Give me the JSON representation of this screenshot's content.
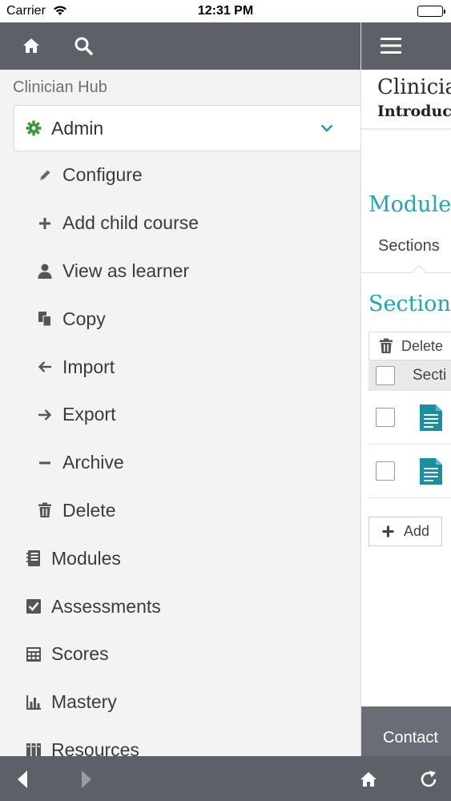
{
  "status_bar": {
    "carrier": "Carrier",
    "time": "12:31 PM"
  },
  "drawer": {
    "hub_title": "Clinician Hub",
    "admin": {
      "label": "Admin",
      "icon": "gear-icon",
      "accent": "#3a9a3a"
    },
    "admin_items": [
      {
        "label": "Configure",
        "icon": "pencil-icon"
      },
      {
        "label": "Add child course",
        "icon": "plus-icon"
      },
      {
        "label": "View as learner",
        "icon": "person-icon"
      },
      {
        "label": "Copy",
        "icon": "copy-icon"
      },
      {
        "label": "Import",
        "icon": "arrow-left-icon"
      },
      {
        "label": "Export",
        "icon": "arrow-right-icon"
      },
      {
        "label": "Archive",
        "icon": "minus-icon"
      },
      {
        "label": "Delete",
        "icon": "trash-icon"
      }
    ],
    "main_items": [
      {
        "label": "Modules",
        "icon": "notebook-icon"
      },
      {
        "label": "Assessments",
        "icon": "checkbox-icon"
      },
      {
        "label": "Scores",
        "icon": "calculator-icon"
      },
      {
        "label": "Mastery",
        "icon": "bar-chart-icon"
      },
      {
        "label": "Resources",
        "icon": "books-icon"
      }
    ]
  },
  "content": {
    "course_title": "Clinicia",
    "course_subtitle": "Introduct",
    "module_heading": "Module",
    "tab_sections": "Sections",
    "sections_heading": "Section",
    "delete_label": "Delete",
    "header_col": "Secti",
    "rows": [
      {
        "icon": "document-icon"
      },
      {
        "icon": "document-icon"
      }
    ],
    "add_label": "Add",
    "footer_contact": "Contact",
    "accent": "#1ea5b8"
  },
  "colors": {
    "header_bg": "#5d6167",
    "drawer_bg": "#f3f3f3",
    "doc_icon": "#1a8fa0"
  }
}
